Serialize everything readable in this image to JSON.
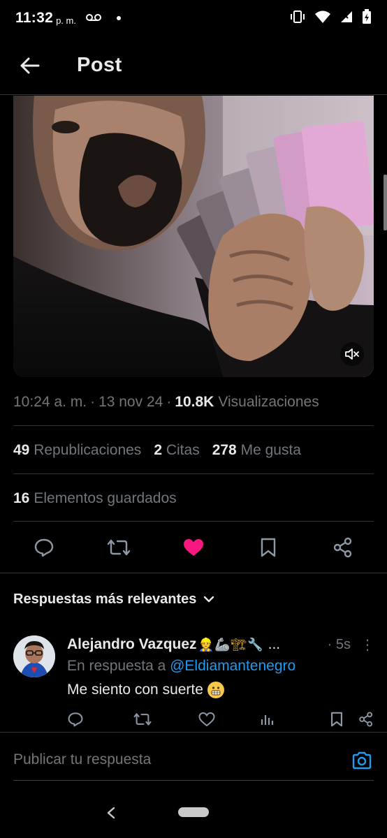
{
  "status_bar": {
    "time": "11:32",
    "ampm": "p. m.",
    "voicemail_icon": "voicemail-icon",
    "vibrate_icon": "vibrate-icon",
    "wifi_icon": "wifi-icon",
    "signal_icon": "signal-icon",
    "battery_icon": "battery-icon"
  },
  "header": {
    "back_icon": "arrow-left-icon",
    "title": "Post"
  },
  "media": {
    "description_icon": "video-thumbnail",
    "mute_icon": "speaker-muted-icon"
  },
  "post_meta": {
    "time": "10:24 a. m.",
    "separator": "·",
    "date": "13 nov 24",
    "views_count": "10.8K",
    "views_label": "Visualizaciones"
  },
  "stats": {
    "reposts_count": "49",
    "reposts_label": "Republicaciones",
    "quotes_count": "2",
    "quotes_label": "Citas",
    "likes_count": "278",
    "likes_label": "Me gusta"
  },
  "saved": {
    "count": "16",
    "label": "Elementos guardados"
  },
  "actions": {
    "reply_icon": "reply-icon",
    "repost_icon": "repost-icon",
    "like_icon": "heart-filled-icon",
    "bookmark_icon": "bookmark-icon",
    "share_icon": "share-icon",
    "like_color": "#f91880"
  },
  "replies_section": {
    "title": "Respuestas más relevantes",
    "chevron_icon": "chevron-down-icon"
  },
  "reply": {
    "author": "Alejandro Vazquez",
    "author_emojis": "👷🦾🏗🔧",
    "ellipsis": "...",
    "time": "· 5s",
    "more": "⋮",
    "in_reply_prefix": "En respuesta a",
    "in_reply_handle": "@Eldiamantenegro",
    "text": "Me siento con suerte",
    "text_emoji": "grimacing-face-emoji",
    "actions": {
      "reply_icon": "reply-icon",
      "repost_icon": "repost-icon",
      "like_icon": "heart-icon",
      "views_icon": "analytics-icon",
      "bookmark_icon": "bookmark-icon",
      "share_icon": "share-icon"
    }
  },
  "compose": {
    "placeholder": "Publicar tu respuesta",
    "camera_icon": "camera-icon",
    "accent_color": "#1d9bf0"
  },
  "nav_bar": {
    "back_icon": "nav-back-icon",
    "home_icon": "home-pill-icon"
  }
}
